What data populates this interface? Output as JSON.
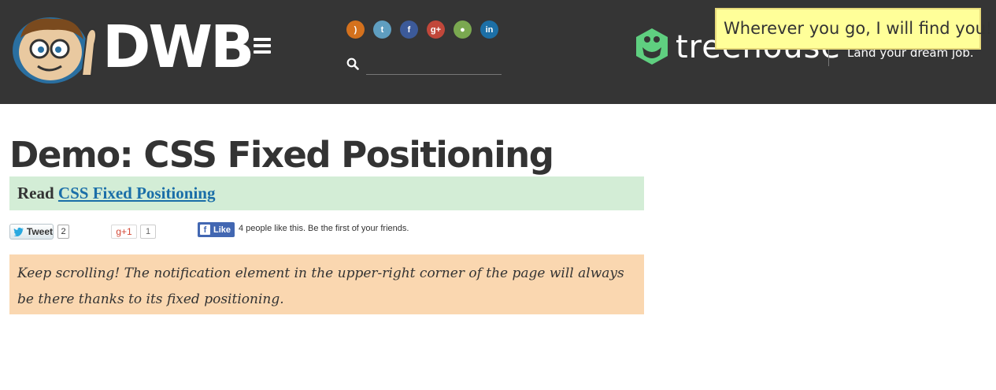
{
  "header": {
    "logo_text": "DWB",
    "social_icons": [
      {
        "name": "rss-icon",
        "glyph": ")",
        "color": "#d4711d"
      },
      {
        "name": "twitter-icon",
        "glyph": "t",
        "color": "#5f9ec0"
      },
      {
        "name": "facebook-icon",
        "glyph": "f",
        "color": "#3c5a99"
      },
      {
        "name": "google-plus-icon",
        "glyph": "g+",
        "color": "#c1473a"
      },
      {
        "name": "github-icon",
        "glyph": "●",
        "color": "#7aa850"
      },
      {
        "name": "linkedin-icon",
        "glyph": "in",
        "color": "#1c6fa6"
      }
    ],
    "search": {
      "placeholder": "",
      "value": ""
    }
  },
  "ad": {
    "brand": "treehouse",
    "tagline": "Land your dream job.",
    "accent": "#5fcf80"
  },
  "notification": {
    "text": "Wherever you go, I will find you!"
  },
  "main": {
    "title": "Demo: CSS Fixed Positioning",
    "read_prefix": "Read",
    "read_link": "CSS Fixed Positioning",
    "note": "Keep scrolling! The notification element in the upper-right corner of the page will always be there thanks to its fixed positioning."
  },
  "share": {
    "tweet_label": "Tweet",
    "tweet_count": "2",
    "gplus_label": "g+1",
    "gplus_count": "1",
    "fb_label": "Like",
    "fb_text": "4 people like this. Be the first of your friends."
  },
  "colors": {
    "header_bg": "#353535",
    "read_box_bg": "#d3edd6",
    "note_box_bg": "#fad7b0",
    "notification_bg": "#ffff99",
    "link": "#1a6ea8"
  }
}
